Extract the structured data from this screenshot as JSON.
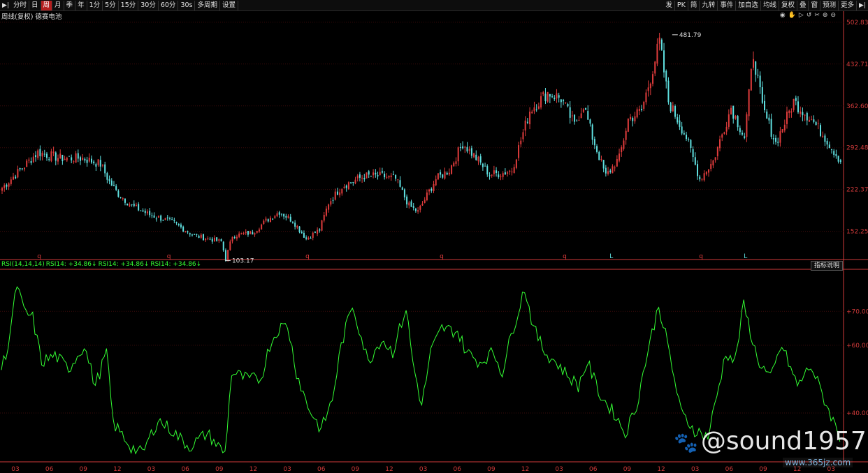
{
  "toolbar": {
    "left": [
      "分时",
      "日",
      "周",
      "月",
      "季",
      "年",
      "1分",
      "5分",
      "15分",
      "30分",
      "60分",
      "30s",
      "多周期",
      "设置"
    ],
    "active": "周",
    "right": [
      "发",
      "PK",
      "简",
      "九转",
      "事件",
      "加自选",
      "均线",
      "复权",
      "叠",
      "窗",
      "预测",
      "更多"
    ]
  },
  "header": {
    "stock_line": "周线(复权) 德赛电池"
  },
  "rsi": {
    "legend": [
      "RSI(14,14,14)",
      "RSI14: +34.86↓",
      "RSI14: +34.86↓",
      "RSI14: +34.86↓"
    ],
    "button": "指标说明"
  },
  "watermark": "@sound1957",
  "site": "www.365jz.com",
  "colors": {
    "up": "#e03c3c",
    "down": "#5fe0e0",
    "rsi": "#33ff33",
    "axis": "#d13a3a",
    "grid": "#3a0b0b"
  },
  "chart_data": [
    {
      "type": "candlestick",
      "price_axis_ticks": [
        502.83,
        432.71,
        362.6,
        292.48,
        222.37,
        152.25
      ],
      "ylim": [
        105,
        505
      ],
      "annotations": [
        {
          "label": "481.79",
          "x": 300
        },
        {
          "label": "103.17",
          "x": 100
        }
      ],
      "marker_labels": [
        {
          "text": "q",
          "x": 16
        },
        {
          "text": "q",
          "x": 74
        },
        {
          "text": "q",
          "x": 136
        },
        {
          "text": "q",
          "x": 196
        },
        {
          "text": "q",
          "x": 251
        },
        {
          "text": "L",
          "x": 272
        },
        {
          "text": "q",
          "x": 312
        },
        {
          "text": "L",
          "x": 332
        }
      ],
      "anchors": [
        [
          0,
          225
        ],
        [
          8,
          255
        ],
        [
          16,
          285
        ],
        [
          26,
          275
        ],
        [
          36,
          275
        ],
        [
          44,
          265
        ],
        [
          48,
          235
        ],
        [
          52,
          215
        ],
        [
          58,
          195
        ],
        [
          66,
          180
        ],
        [
          76,
          168
        ],
        [
          86,
          145
        ],
        [
          98,
          135
        ],
        [
          100,
          106
        ],
        [
          103,
          145
        ],
        [
          112,
          150
        ],
        [
          118,
          170
        ],
        [
          124,
          185
        ],
        [
          130,
          170
        ],
        [
          136,
          140
        ],
        [
          142,
          155
        ],
        [
          146,
          200
        ],
        [
          152,
          228
        ],
        [
          162,
          245
        ],
        [
          170,
          245
        ],
        [
          176,
          240
        ],
        [
          182,
          195
        ],
        [
          186,
          185
        ],
        [
          194,
          240
        ],
        [
          200,
          255
        ],
        [
          206,
          300
        ],
        [
          212,
          275
        ],
        [
          218,
          248
        ],
        [
          224,
          250
        ],
        [
          228,
          255
        ],
        [
          236,
          355
        ],
        [
          244,
          385
        ],
        [
          250,
          375
        ],
        [
          256,
          330
        ],
        [
          260,
          365
        ],
        [
          264,
          310
        ],
        [
          270,
          245
        ],
        [
          276,
          275
        ],
        [
          280,
          340
        ],
        [
          286,
          355
        ],
        [
          290,
          410
        ],
        [
          294,
          470
        ],
        [
          298,
          370
        ],
        [
          306,
          310
        ],
        [
          312,
          240
        ],
        [
          318,
          270
        ],
        [
          326,
          360
        ],
        [
          332,
          310
        ],
        [
          336,
          450
        ],
        [
          340,
          360
        ],
        [
          346,
          300
        ],
        [
          354,
          370
        ],
        [
          362,
          340
        ],
        [
          368,
          310
        ],
        [
          375,
          270
        ]
      ],
      "count": 376
    },
    {
      "type": "line",
      "name": "RSI14",
      "yticks": [
        70,
        60,
        40
      ],
      "ylim": [
        26,
        82
      ],
      "anchors": [
        [
          0,
          53
        ],
        [
          3,
          60
        ],
        [
          7,
          78
        ],
        [
          10,
          70
        ],
        [
          14,
          68
        ],
        [
          18,
          55
        ],
        [
          24,
          57
        ],
        [
          30,
          53
        ],
        [
          37,
          60
        ],
        [
          42,
          48
        ],
        [
          47,
          58
        ],
        [
          50,
          37
        ],
        [
          58,
          30
        ],
        [
          63,
          28
        ],
        [
          70,
          38
        ],
        [
          76,
          35
        ],
        [
          84,
          30
        ],
        [
          92,
          34
        ],
        [
          100,
          28
        ],
        [
          103,
          52
        ],
        [
          110,
          50
        ],
        [
          116,
          50
        ],
        [
          120,
          60
        ],
        [
          124,
          65
        ],
        [
          128,
          66
        ],
        [
          132,
          52
        ],
        [
          137,
          42
        ],
        [
          143,
          35
        ],
        [
          148,
          44
        ],
        [
          152,
          60
        ],
        [
          157,
          72
        ],
        [
          160,
          65
        ],
        [
          164,
          55
        ],
        [
          170,
          62
        ],
        [
          175,
          58
        ],
        [
          181,
          71
        ],
        [
          184,
          55
        ],
        [
          188,
          42
        ],
        [
          192,
          58
        ],
        [
          197,
          65
        ],
        [
          204,
          64
        ],
        [
          208,
          58
        ],
        [
          214,
          55
        ],
        [
          220,
          58
        ],
        [
          224,
          52
        ],
        [
          228,
          63
        ],
        [
          234,
          77
        ],
        [
          238,
          65
        ],
        [
          243,
          58
        ],
        [
          248,
          55
        ],
        [
          252,
          52
        ],
        [
          258,
          48
        ],
        [
          262,
          55
        ],
        [
          268,
          45
        ],
        [
          274,
          40
        ],
        [
          279,
          34
        ],
        [
          284,
          42
        ],
        [
          288,
          55
        ],
        [
          294,
          72
        ],
        [
          298,
          60
        ],
        [
          304,
          40
        ],
        [
          310,
          35
        ],
        [
          316,
          33
        ],
        [
          320,
          45
        ],
        [
          324,
          58
        ],
        [
          328,
          55
        ],
        [
          332,
          72
        ],
        [
          338,
          56
        ],
        [
          344,
          50
        ],
        [
          349,
          60
        ],
        [
          356,
          48
        ],
        [
          362,
          54
        ],
        [
          368,
          44
        ],
        [
          375,
          33
        ]
      ],
      "count": 376
    }
  ],
  "x_axis_labels": [
    "03",
    "06",
    "09",
    "12",
    "03",
    "06",
    "09",
    "12",
    "03",
    "06",
    "09",
    "12",
    "03",
    "06",
    "09",
    "12",
    "03",
    "06",
    "09",
    "12",
    "03",
    "06",
    "09",
    "12",
    "03"
  ]
}
